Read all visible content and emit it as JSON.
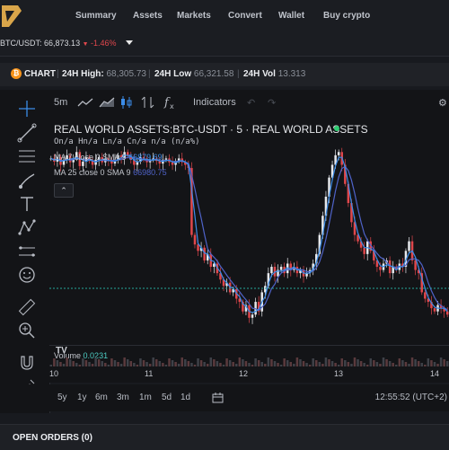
{
  "nav": {
    "items": [
      "Summary",
      "Assets",
      "Markets",
      "Convert",
      "Wallet",
      "Buy crypto"
    ]
  },
  "pair": {
    "symbol": "BTC/USDT:",
    "price": "66,873.13",
    "arrow": "▼",
    "change": "-1.46%"
  },
  "stats": {
    "chart_label": "CHART",
    "high_label": "24H High:",
    "high_value": "68,305.73",
    "low_label": "24H Low",
    "low_value": "66,321.58",
    "vol_label": "24H Vol",
    "vol_value": "13.313"
  },
  "toolbar": {
    "interval": "5m",
    "indicators_label": "Indicators"
  },
  "legend": {
    "title": "REAL WORLD ASSETS:BTC-USDT · 5 · REAL WORLD ASSETS",
    "ohlc": "On/a Hn/a Ln/a Cn/a n/a (n/a%)",
    "ma7_label": "MA 7 close 0 SMA 9",
    "ma7_value": "66879.69",
    "ma25_label": "MA 25 close 0 SMA 9",
    "ma25_value": "66980.75"
  },
  "volume": {
    "label": "Volume",
    "value": "0.0231"
  },
  "xaxis": {
    "ticks": [
      "10",
      "11",
      "12",
      "13",
      "14"
    ]
  },
  "ranges": [
    "5y",
    "1y",
    "6m",
    "3m",
    "1m",
    "5d",
    "1d"
  ],
  "clock": "12:55:52 (UTC+2)",
  "orders": {
    "label": "OPEN ORDERS (0)"
  },
  "colors": {
    "up": "#e6e8ec",
    "down": "#e0474c",
    "ma7": "#3b8ce8",
    "ma25": "#4f63c9",
    "price_line": "#26a69a",
    "accent_btc": "#f7931a",
    "status_dot": "#2ecc71"
  },
  "chart_data": {
    "type": "candlestick",
    "x_ticks": [
      "10",
      "11",
      "12",
      "13",
      "14"
    ],
    "close_approx": [
      67600,
      67550,
      67620,
      67500,
      67580,
      67650,
      67540,
      67600,
      67700,
      67480,
      67550,
      67620,
      67560,
      67500,
      67580,
      67620,
      67540,
      67600,
      67560,
      67520,
      67580,
      67650,
      67600,
      67700,
      67640,
      67580,
      67500,
      67550,
      67620,
      67600,
      67540,
      67580,
      67600,
      67560,
      67520,
      67580,
      67600,
      67540,
      67500,
      67560,
      67600,
      67540,
      67500,
      67450,
      66400,
      66250,
      66150,
      66200,
      66000,
      66100,
      65900,
      65950,
      65800,
      65700,
      65600,
      65650,
      65500,
      65550,
      65400,
      65350,
      65200,
      65300,
      65100,
      65150,
      65350,
      65200,
      65500,
      65600,
      65800,
      65900,
      65750,
      65850,
      65900,
      65800,
      65950,
      65850,
      65900,
      65800,
      65850,
      65750,
      65800,
      65850,
      65950,
      66100,
      66400,
      66700,
      67000,
      67300,
      67500,
      67650,
      67700,
      67500,
      67200,
      66900,
      66600,
      66400,
      66300,
      66200,
      66100,
      66300,
      66150,
      66000,
      65900,
      65850,
      65950,
      66000,
      65800,
      65900,
      65850,
      65950,
      65900,
      66150,
      66300,
      66000,
      65850,
      65800,
      65500,
      65400,
      65350,
      65250,
      65200,
      65300,
      65250,
      65200,
      65150
    ]
  }
}
